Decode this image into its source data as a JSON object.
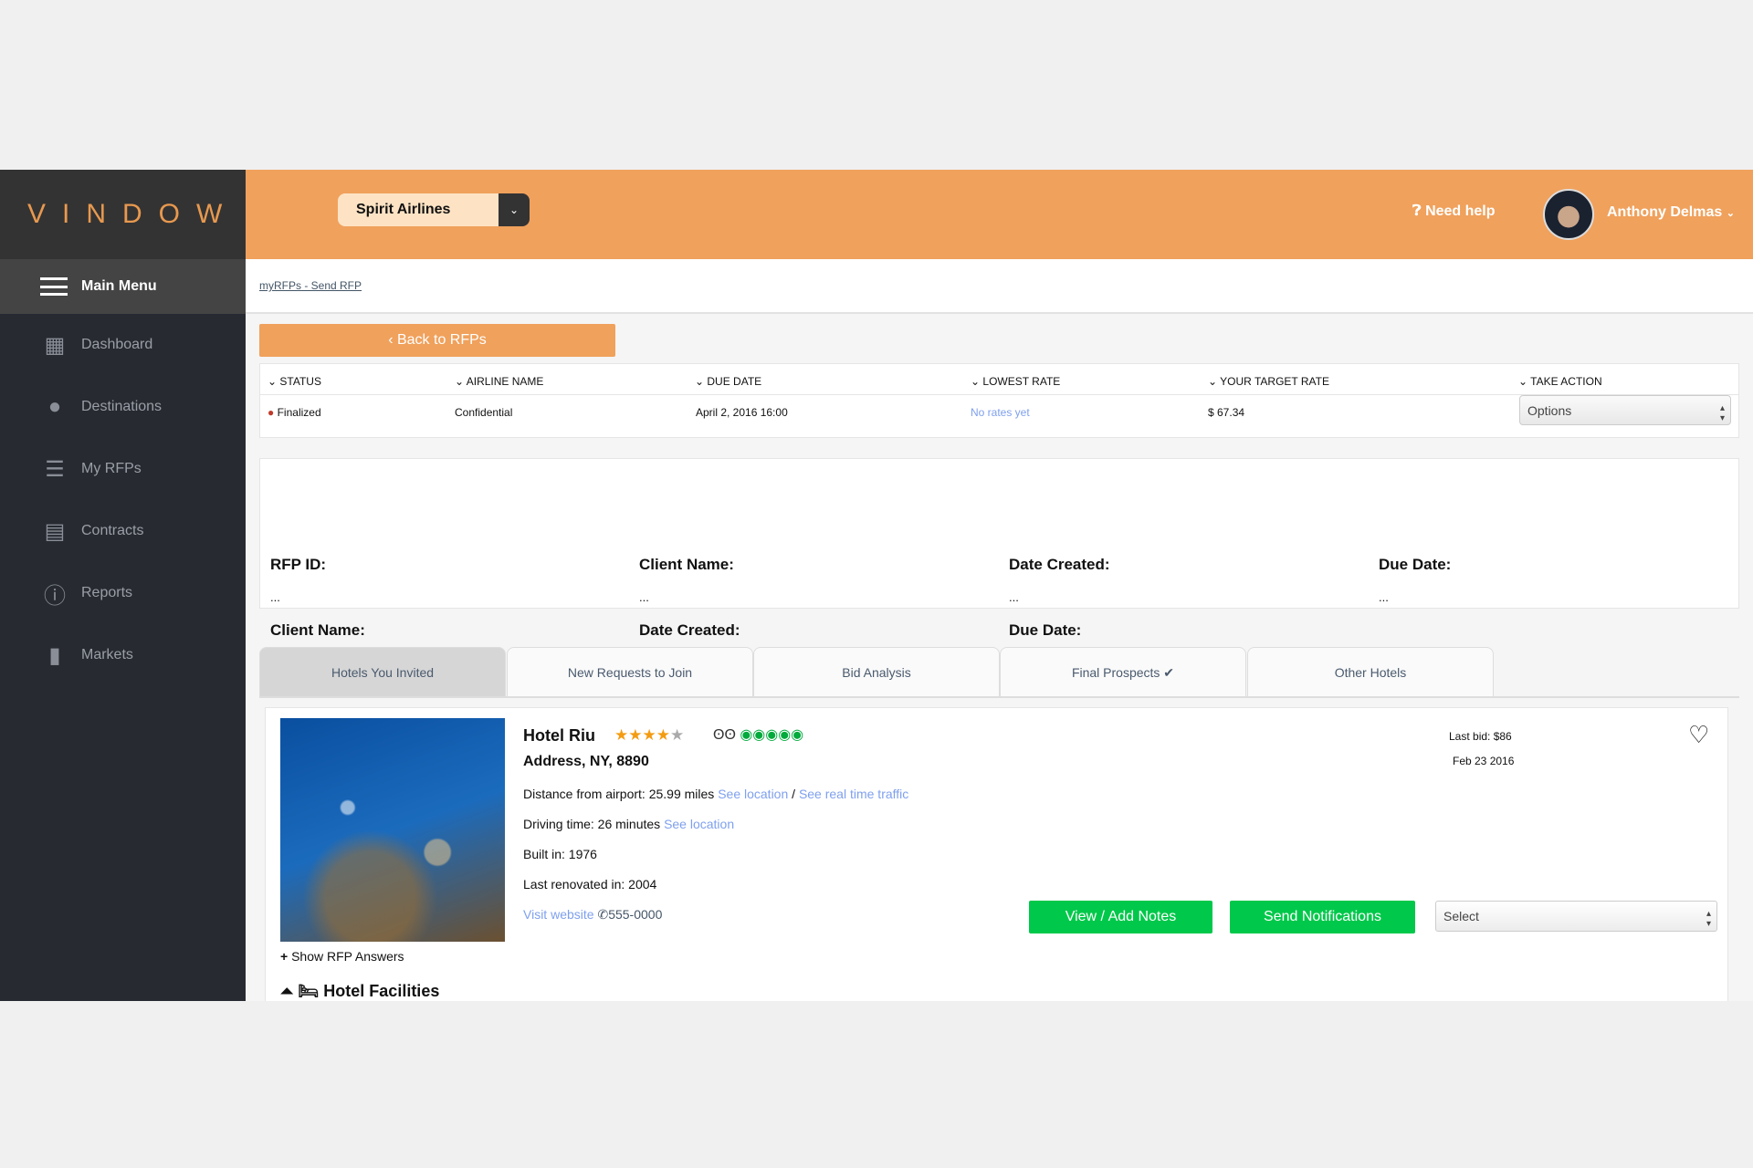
{
  "brand": {
    "logo": "VINDOW",
    "accent": "#f0a15c",
    "sidebar_bg": "#272a31",
    "button_green": "#00c84a"
  },
  "header": {
    "airline_select": "Spirit Airlines",
    "help": "Need help",
    "user_name": "Anthony Delmas"
  },
  "sidebar": {
    "main_menu": "Main Menu",
    "items": [
      {
        "label": "Dashboard",
        "icon": "grid-icon"
      },
      {
        "label": "Destinations",
        "icon": "globe-icon"
      },
      {
        "label": "My RFPs",
        "icon": "user-list-icon"
      },
      {
        "label": "Contracts",
        "icon": "clipboard-icon"
      },
      {
        "label": "Reports",
        "icon": "info-icon"
      },
      {
        "label": "Markets",
        "icon": "bar-chart-icon"
      }
    ]
  },
  "breadcrumb": "myRFPs - Send RFP",
  "back_button": "Back to RFPs",
  "rfp_table": {
    "headers": [
      "STATUS",
      "AIRLINE NAME",
      "DUE DATE",
      "LOWEST RATE",
      "YOUR TARGET RATE",
      "TAKE ACTION"
    ],
    "row": {
      "status": "Finalized",
      "status_color": "#c0392b",
      "airline": "Confidential",
      "due_date": "April 2, 2016 16:00",
      "lowest_rate": "No rates yet",
      "target_rate": "$ 67.34",
      "action": "Options"
    }
  },
  "info": {
    "row1": [
      {
        "label": "RFP ID:",
        "value": "..."
      },
      {
        "label": "Client Name:",
        "value": "..."
      },
      {
        "label": "Date Created:",
        "value": "..."
      },
      {
        "label": "Due Date:",
        "value": "..."
      }
    ],
    "row2": [
      {
        "label": "Client Name:",
        "value": "..."
      },
      {
        "label": "Date Created:",
        "value": "..."
      },
      {
        "label": "Due Date:",
        "value": "..."
      }
    ]
  },
  "tabs": [
    "Hotels You Invited",
    "New Requests to Join",
    "Bid Analysis",
    "Final Prospects ✔",
    "Other Hotels"
  ],
  "active_tab": 0,
  "hotel": {
    "name": "Hotel Riu",
    "stars": 4,
    "max_stars": 5,
    "tripadvisor_rating": 5,
    "address": "Address, NY, 8890",
    "distance": "Distance from airport: 25.99 miles",
    "see_location": "See location",
    "slash": "/",
    "see_traffic": "See real time traffic",
    "driving": "Driving time: 26 minutes",
    "see_location2": "See location",
    "built": "Built in: 1976",
    "renovated": "Last renovated in: 2004",
    "website": "Visit website",
    "phone": "555-0000",
    "last_bid": "Last bid: $86",
    "bid_date": "Feb 23 2016",
    "notes_button": "View / Add Notes",
    "notify_button": "Send Notifications",
    "select": "Select",
    "show_answers": "Show RFP Answers",
    "facilities": "Hotel Facilities"
  }
}
